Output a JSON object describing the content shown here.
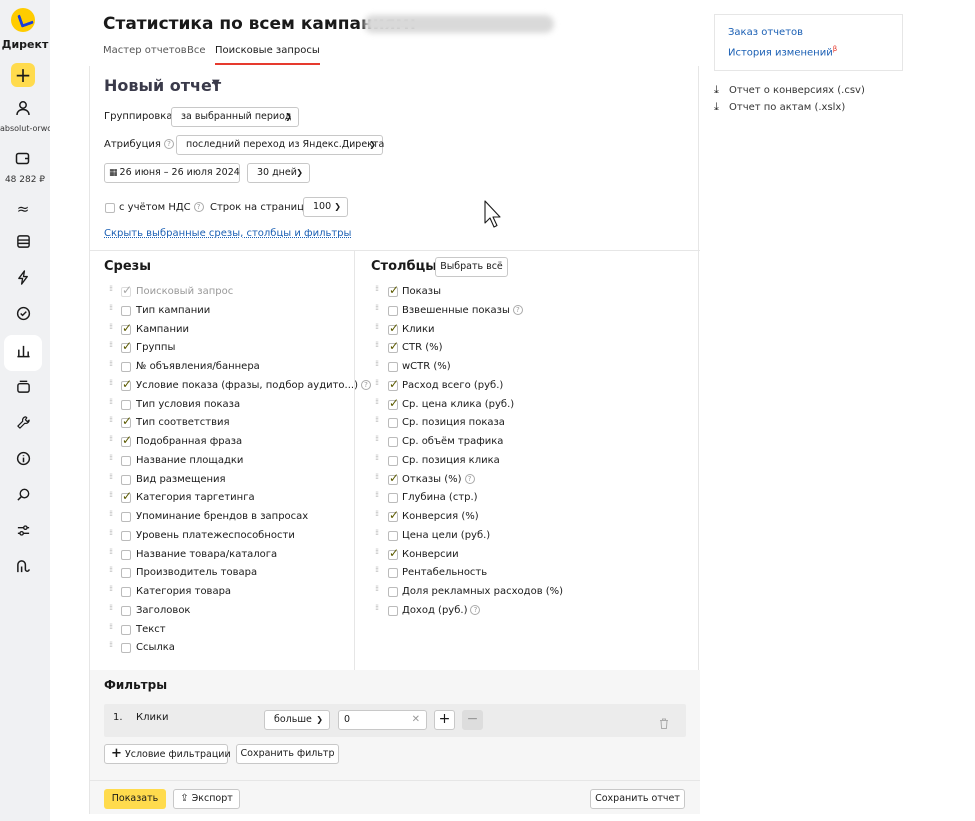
{
  "sidebar": {
    "logo_text": "Директ",
    "account": "absolut-orwo",
    "balance": "48 282 ₽"
  },
  "header": {
    "title": "Статистика по всем кампаниям:",
    "tabs": [
      {
        "label": "Мастер отчетов",
        "active": false
      },
      {
        "label": "Все",
        "active": false
      },
      {
        "label": "Поисковые запросы",
        "active": true
      }
    ]
  },
  "report": {
    "title": "Новый отчет",
    "grouping_label": "Группировка",
    "grouping_value": "за выбранный период",
    "attribution_label": "Атрибуция",
    "attribution_value": "последний переход из Яндекс.Директа",
    "date_range": "26 июня – 26 июля 2024",
    "period": "30 дней",
    "vat_label": "с учётом НДС",
    "vat_checked": false,
    "rows_label": "Строк на странице",
    "rows_value": "100",
    "hide_link": "Скрыть выбранные срезы, столбцы и фильтры"
  },
  "slices": {
    "title": "Срезы",
    "items": [
      {
        "label": "Поисковый запрос",
        "checked": true,
        "disabled": true,
        "help": false
      },
      {
        "label": "Тип кампании",
        "checked": false,
        "disabled": false,
        "help": false
      },
      {
        "label": "Кампании",
        "checked": true,
        "disabled": false,
        "help": false
      },
      {
        "label": "Группы",
        "checked": true,
        "disabled": false,
        "help": false
      },
      {
        "label": "№ объявления/баннера",
        "checked": false,
        "disabled": false,
        "help": false
      },
      {
        "label": "Условие показа (фразы, подбор аудито...)",
        "checked": true,
        "disabled": false,
        "help": true
      },
      {
        "label": "Тип условия показа",
        "checked": false,
        "disabled": false,
        "help": false
      },
      {
        "label": "Тип соответствия",
        "checked": true,
        "disabled": false,
        "help": false
      },
      {
        "label": "Подобранная фраза",
        "checked": true,
        "disabled": false,
        "help": false
      },
      {
        "label": "Название площадки",
        "checked": false,
        "disabled": false,
        "help": false
      },
      {
        "label": "Вид размещения",
        "checked": false,
        "disabled": false,
        "help": false
      },
      {
        "label": "Категория таргетинга",
        "checked": true,
        "disabled": false,
        "help": false
      },
      {
        "label": "Упоминание брендов в запросах",
        "checked": false,
        "disabled": false,
        "help": false
      },
      {
        "label": "Уровень платежеспособности",
        "checked": false,
        "disabled": false,
        "help": false
      },
      {
        "label": "Название товара/каталога",
        "checked": false,
        "disabled": false,
        "help": false
      },
      {
        "label": "Производитель товара",
        "checked": false,
        "disabled": false,
        "help": false
      },
      {
        "label": "Категория товара",
        "checked": false,
        "disabled": false,
        "help": false
      },
      {
        "label": "Заголовок",
        "checked": false,
        "disabled": false,
        "help": false
      },
      {
        "label": "Текст",
        "checked": false,
        "disabled": false,
        "help": false
      },
      {
        "label": "Ссылка",
        "checked": false,
        "disabled": false,
        "help": false
      }
    ]
  },
  "columns": {
    "title": "Столбцы",
    "select_all": "Выбрать всё",
    "items": [
      {
        "label": "Показы",
        "checked": true,
        "help": false
      },
      {
        "label": "Взвешенные показы",
        "checked": false,
        "help": true
      },
      {
        "label": "Клики",
        "checked": true,
        "help": false
      },
      {
        "label": "CTR (%)",
        "checked": true,
        "help": false
      },
      {
        "label": "wCTR (%)",
        "checked": false,
        "help": false
      },
      {
        "label": "Расход всего (руб.)",
        "checked": true,
        "help": false
      },
      {
        "label": "Ср. цена клика (руб.)",
        "checked": true,
        "help": false
      },
      {
        "label": "Ср. позиция показа",
        "checked": false,
        "help": false
      },
      {
        "label": "Ср. объём трафика",
        "checked": false,
        "help": false
      },
      {
        "label": "Ср. позиция клика",
        "checked": false,
        "help": false
      },
      {
        "label": "Отказы (%)",
        "checked": true,
        "help": true
      },
      {
        "label": "Глубина (стр.)",
        "checked": false,
        "help": false
      },
      {
        "label": "Конверсия (%)",
        "checked": true,
        "help": false
      },
      {
        "label": "Цена цели (руб.)",
        "checked": false,
        "help": false
      },
      {
        "label": "Конверсии",
        "checked": true,
        "help": false
      },
      {
        "label": "Рентабельность",
        "checked": false,
        "help": false
      },
      {
        "label": "Доля рекламных расходов (%)",
        "checked": false,
        "help": false
      },
      {
        "label": "Доход (руб.)",
        "checked": false,
        "help": true
      }
    ]
  },
  "filters": {
    "title": "Фильтры",
    "rows": [
      {
        "index": "1.",
        "field": "Клики",
        "operator": "больше",
        "value": "0"
      }
    ],
    "add_condition": "Условие фильтрации",
    "save_filter": "Сохранить фильтр"
  },
  "footer": {
    "show": "Показать",
    "export": "Экспорт",
    "save_report": "Сохранить отчет"
  },
  "right_panel": {
    "order_reports": "Заказ отчетов",
    "history": "История изменений",
    "history_badge": "β",
    "conversions_report": "Отчет о конверсиях (.csv)",
    "acts_report": "Отчет по актам (.xslx)"
  }
}
